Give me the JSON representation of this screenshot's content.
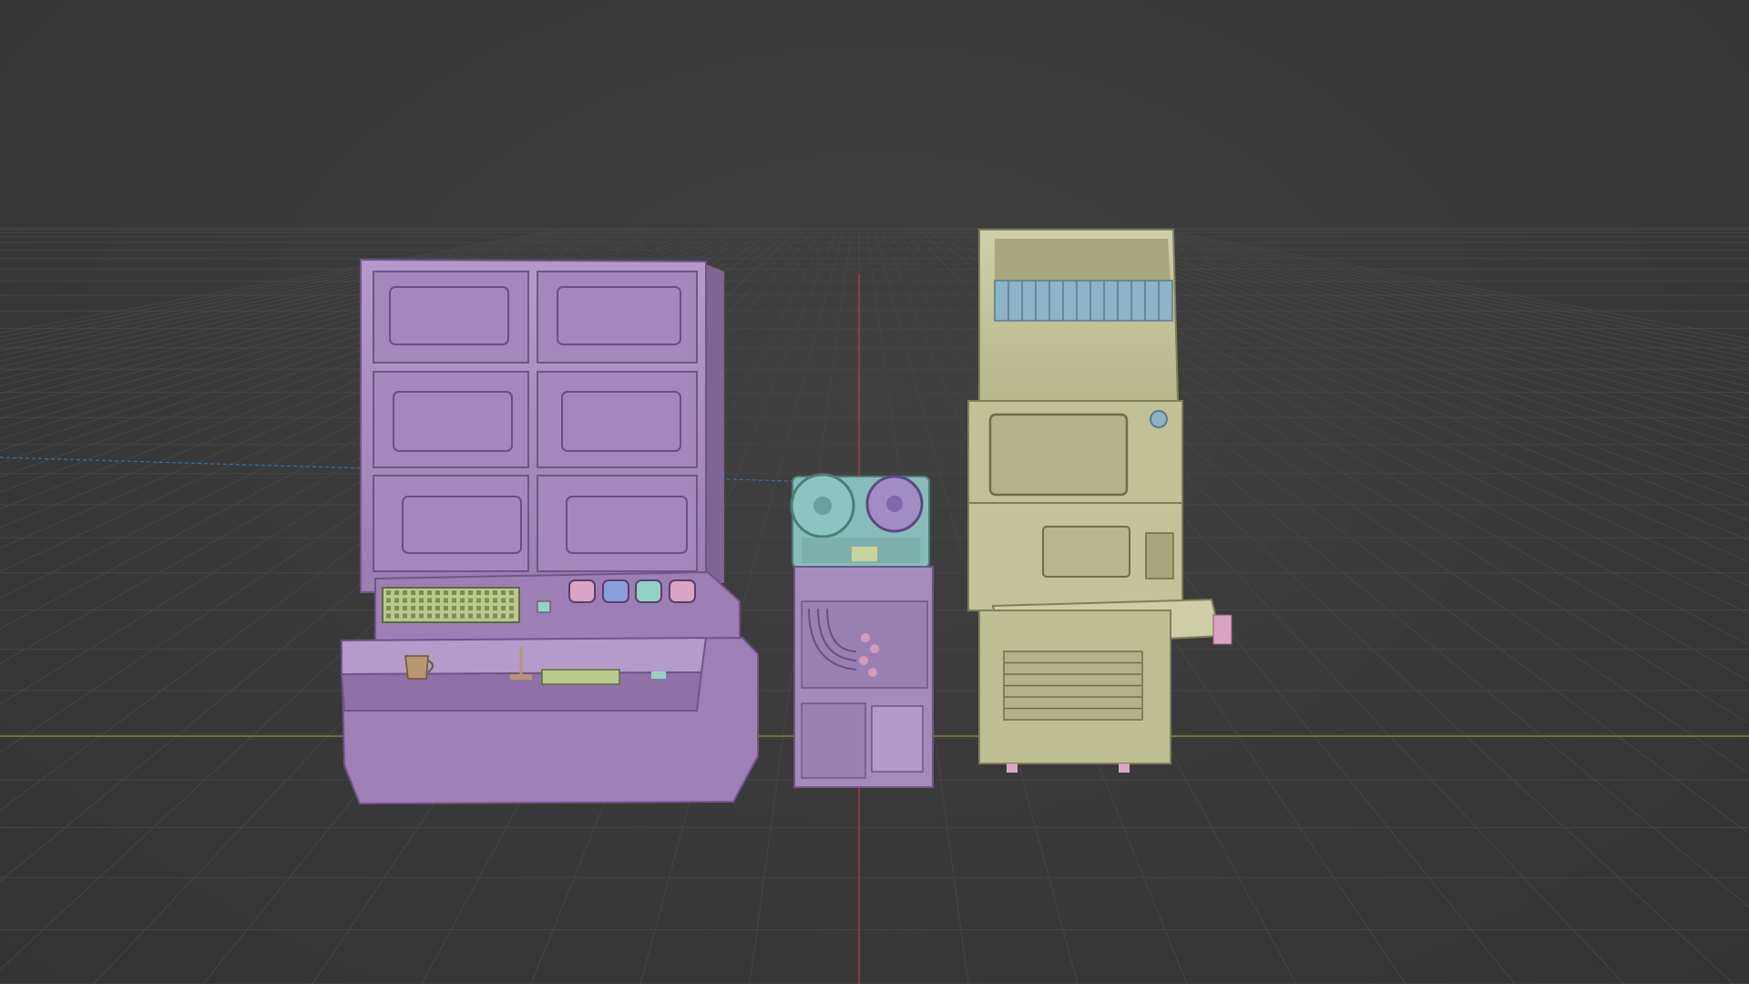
{
  "viewport": {
    "background": "#3a3a3a",
    "grid_color": "#4a4a4a",
    "x_axis_color": "#6c8f3a",
    "y_axis_color": "#3a6fa8",
    "z_axis_color": "#b04848"
  },
  "objects": [
    {
      "name": "mainframe-console",
      "color": "#a98bc0"
    },
    {
      "name": "reel-to-reel-tape-unit",
      "color": "#86bdb8"
    },
    {
      "name": "rack-cabinet",
      "color": "#a58bbd"
    },
    {
      "name": "terminal-workstation",
      "color": "#c3c39a"
    }
  ]
}
